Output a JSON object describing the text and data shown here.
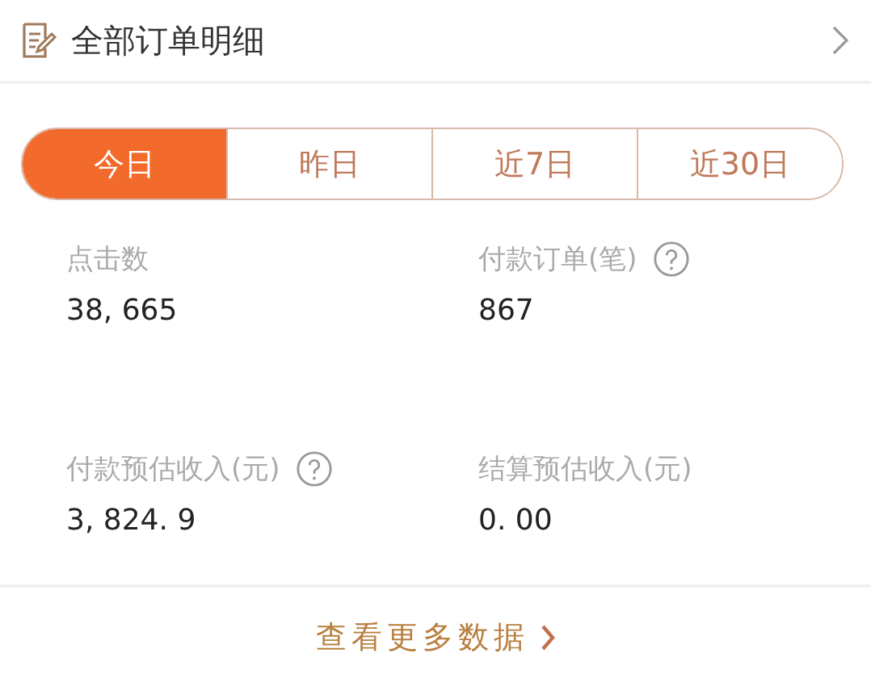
{
  "header": {
    "title": "全部订单明细"
  },
  "tabs": [
    {
      "label": "今日",
      "selected": true
    },
    {
      "label": "昨日",
      "selected": false
    },
    {
      "label": "近7日",
      "selected": false
    },
    {
      "label": "近30日",
      "selected": false
    }
  ],
  "metrics": [
    {
      "label": "点击数",
      "value": "38, 665",
      "help": false
    },
    {
      "label": "付款订单(笔)",
      "value": "867",
      "help": true
    },
    {
      "label": "付款预估收入(元)",
      "value": "3, 824. 9",
      "help": true
    },
    {
      "label": "结算预估收入(元)",
      "value": "0. 00",
      "help": false
    }
  ],
  "footer_link": {
    "label": "查看更多数据"
  }
}
